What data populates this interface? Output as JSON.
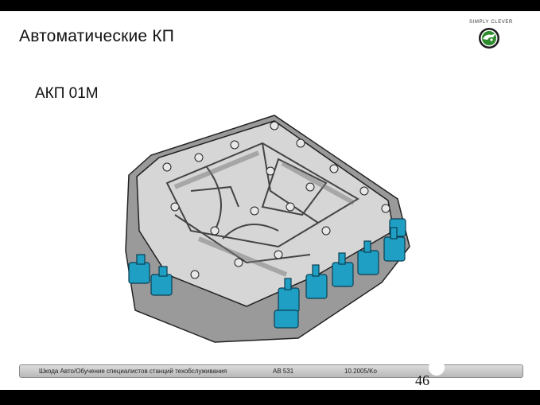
{
  "slide": {
    "title": "Автоматические КП",
    "subtitle": "АКП 01М",
    "page_number": "46"
  },
  "brand": {
    "slogan": "SIMPLY CLEVER",
    "logo_icon": "skoda-logo-icon",
    "logo_colors": {
      "ring": "#1a1a1a",
      "inner": "#2e8b2e"
    }
  },
  "figure": {
    "icon": "valve-body-illustration",
    "colors": {
      "housing": "#cfcfcf",
      "housing_dark": "#8c8c8c",
      "solenoids": "#1f9fc4"
    }
  },
  "footer": {
    "left": "Шкода Авто/Обучение специалистов станций техобслуживания",
    "middle": "AB 531",
    "right": "10.2005/Ko"
  }
}
